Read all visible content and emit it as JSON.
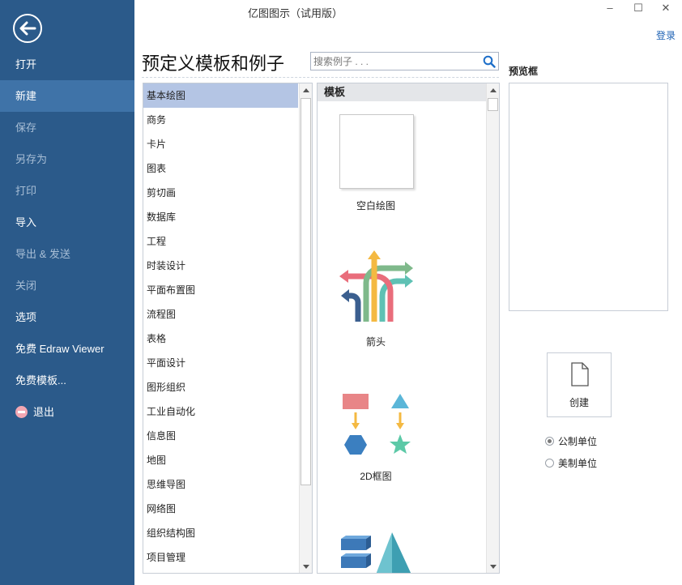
{
  "window": {
    "title": "亿图图示（试用版）",
    "controls": {
      "minimize": "–",
      "maximize": "☐",
      "close": "✕"
    },
    "login": "登录"
  },
  "sidebar": {
    "back_icon": "arrow-left-icon",
    "items": [
      {
        "label": "打开",
        "state": "normal"
      },
      {
        "label": "新建",
        "state": "active"
      },
      {
        "label": "保存",
        "state": "disabled"
      },
      {
        "label": "另存为",
        "state": "disabled"
      },
      {
        "label": "打印",
        "state": "disabled"
      },
      {
        "label": "导入",
        "state": "normal"
      },
      {
        "label": "导出 & 发送",
        "state": "disabled"
      },
      {
        "label": "关闭",
        "state": "disabled"
      },
      {
        "label": "选项",
        "state": "normal"
      },
      {
        "label": "免费 Edraw Viewer",
        "state": "normal"
      },
      {
        "label": "免费模板...",
        "state": "normal"
      },
      {
        "label": "退出",
        "state": "normal"
      }
    ]
  },
  "main": {
    "heading": "预定义模板和例子",
    "search": {
      "placeholder": "搜索例子 . . .",
      "value": ""
    }
  },
  "categories": {
    "selected_index": 0,
    "items": [
      "基本绘图",
      "商务",
      "卡片",
      "图表",
      "剪切画",
      "数据库",
      "工程",
      "时装设计",
      "平面布置图",
      "流程图",
      "表格",
      "平面设计",
      "图形组织",
      "工业自动化",
      "信息图",
      "地图",
      "思维导图",
      "网络图",
      "组织结构图",
      "项目管理"
    ]
  },
  "templates": {
    "header": "模板",
    "items": [
      {
        "label": "空白绘图",
        "thumb": "blank-page"
      },
      {
        "label": "箭头",
        "thumb": "arrows-icon"
      },
      {
        "label": "2D框图",
        "thumb": "block-2d-icon"
      },
      {
        "label": "",
        "thumb": "block-3d-icon"
      }
    ]
  },
  "preview": {
    "label": "预览框"
  },
  "create": {
    "label": "创建"
  },
  "units": {
    "selected": "metric",
    "metric": "公制单位",
    "us": "美制单位"
  },
  "colors": {
    "sidebar_bg": "#2b5a8a",
    "sidebar_active": "#3f73a8",
    "selection": "#b4c5e4",
    "link": "#1e62b4"
  }
}
